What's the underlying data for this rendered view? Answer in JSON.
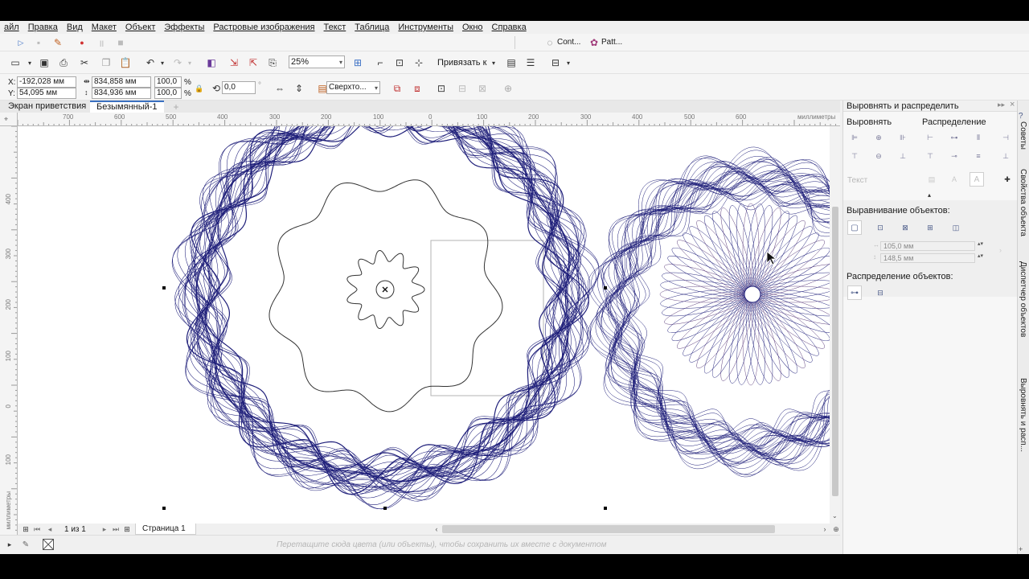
{
  "menu": [
    "айл",
    "Правка",
    "Вид",
    "Макет",
    "Объект",
    "Эффекты",
    "Растровые изображения",
    "Текст",
    "Таблица",
    "Инструменты",
    "Окно",
    "Справка"
  ],
  "quick_tabs": {
    "contour": "Cont...",
    "pattern": "Patt..."
  },
  "standard_toolbar": {
    "zoom": "25%",
    "snap_label": "Привязать к"
  },
  "property_bar": {
    "x_label": "X:",
    "x_value": "-192,028 мм",
    "y_label": "Y:",
    "y_value": "54,095 мм",
    "width_value": "834,858 мм",
    "height_value": "834,936 мм",
    "scale_w": "100,0",
    "scale_h": "100,0",
    "percent": "%",
    "angle": "0,0",
    "angle_unit": "°",
    "order_mode": "Сверхто..."
  },
  "document_tabs": [
    "Экран приветствия",
    "Безымянный-1"
  ],
  "ruler": {
    "h_ticks": [
      "700",
      "600",
      "500",
      "400",
      "300",
      "200",
      "100",
      "0",
      "100",
      "200",
      "300",
      "400",
      "500",
      "600"
    ],
    "h_unit": "миллиметры",
    "v_ticks": [
      "400",
      "300",
      "200",
      "100",
      "0",
      "100"
    ],
    "v_unit": "миллиметры"
  },
  "page_nav": {
    "counter": "1 из 1",
    "page_tab": "Страница 1"
  },
  "status": {
    "hint": "Перетащите сюда цвета (или объекты), чтобы сохранить их вместе с документом"
  },
  "docker": {
    "title": "Выровнять и распределить",
    "align_label": "Выровнять",
    "distribute_label": "Распределение",
    "text_label": "Текст",
    "align_objects_label": "Выравнивание объектов:",
    "pos_x": "105,0 мм",
    "pos_y": "148,5 мм",
    "distribute_objects_label": "Распределение объектов:"
  },
  "side_tabs": [
    "Советы",
    "Свойства объекта",
    "Диспетчер объектов",
    "Выровнять и расп..."
  ],
  "colors": {
    "guilloche": "#1f1f7a",
    "accent_selection": "#000000"
  }
}
